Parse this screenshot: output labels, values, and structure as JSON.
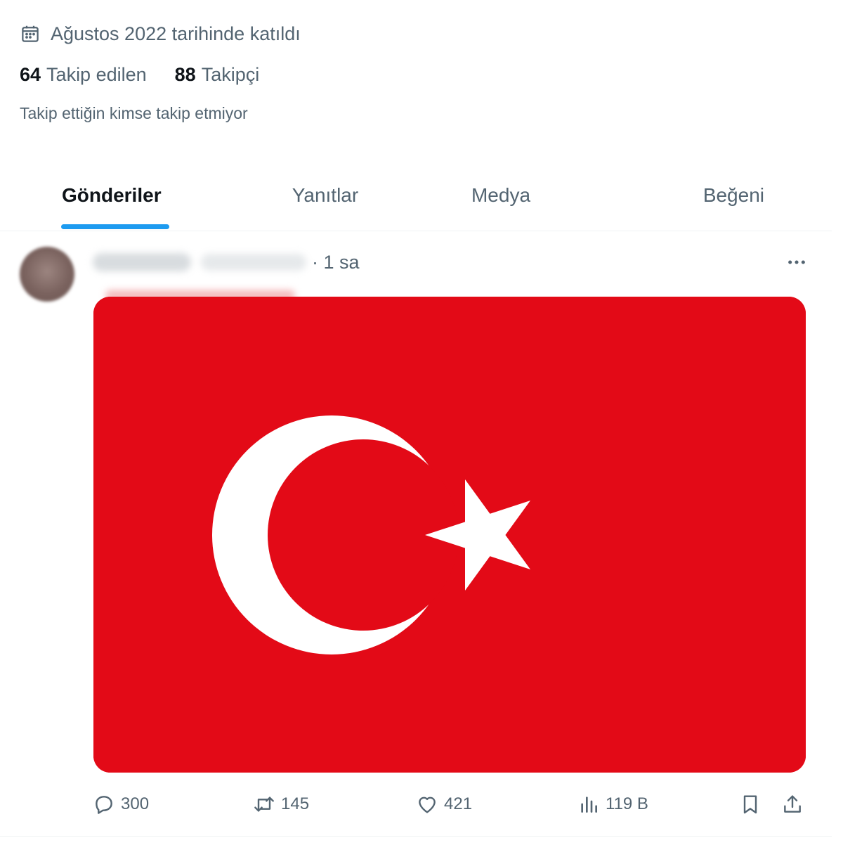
{
  "profile": {
    "joined": "Ağustos 2022 tarihinde katıldı",
    "following_count": "64",
    "following_label": "Takip edilen",
    "followers_count": "88",
    "followers_label": "Takipçi",
    "mutual_note": "Takip ettiğin kimse takip etmiyor"
  },
  "tabs": [
    {
      "label": "Gönderiler",
      "active": true
    },
    {
      "label": "Yanıtlar",
      "active": false
    },
    {
      "label": "Medya",
      "active": false
    },
    {
      "label": "Beğeni",
      "active": false
    }
  ],
  "post": {
    "time": "· 1 sa",
    "image_content": "Turkish flag",
    "stats": {
      "replies": "300",
      "reposts": "145",
      "likes": "421",
      "views": "119 B"
    }
  },
  "colors": {
    "accent": "#1d9bf0",
    "muted_text": "#536471",
    "flag_red": "#e30a17"
  }
}
